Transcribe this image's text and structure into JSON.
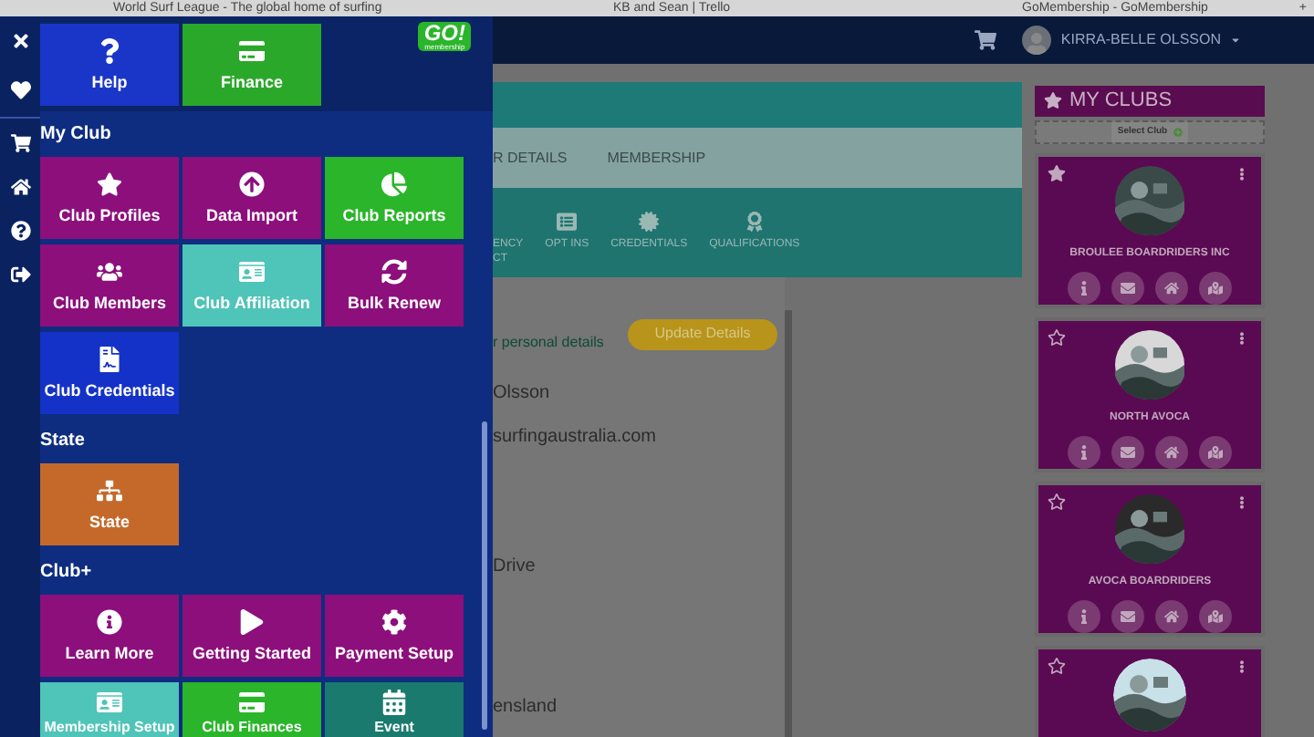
{
  "browser_tabs": [
    {
      "title": "World Surf League - The global home of surfing"
    },
    {
      "title": "KB and Sean | Trello"
    },
    {
      "title": "GoMembership - GoMembership"
    }
  ],
  "new_tab": "+",
  "top_bar": {
    "user_name": "KIRRA-BELLE OLSSON"
  },
  "drawer": {
    "logo": {
      "text": "GO!",
      "tagline": "membership"
    },
    "top_tiles": [
      {
        "label": "Help",
        "color": "#1a36c8"
      },
      {
        "label": "Finance",
        "color": "#2aa82a"
      }
    ],
    "sections": [
      {
        "heading": "My Club",
        "tiles": [
          {
            "label": "Club Profiles",
            "color": "#8c0f7c"
          },
          {
            "label": "Data Import",
            "color": "#8c0f7c"
          },
          {
            "label": "Club Reports",
            "color": "#2ab52a"
          },
          {
            "label": "Club Members",
            "color": "#8c0f7c"
          },
          {
            "label": "Club Affiliation",
            "color": "#4fc4b8"
          },
          {
            "label": "Bulk Renew",
            "color": "#8c0f7c"
          },
          {
            "label": "Club Credentials",
            "color": "#1432c8"
          }
        ]
      },
      {
        "heading": "State",
        "tiles": [
          {
            "label": "State",
            "color": "#c4692a"
          }
        ]
      },
      {
        "heading": "Club+",
        "tiles": [
          {
            "label": "Learn More",
            "color": "#8c0f7c"
          },
          {
            "label": "Getting Started",
            "color": "#8c0f7c"
          },
          {
            "label": "Payment Setup",
            "color": "#8c0f7c"
          },
          {
            "label": "Membership Setup",
            "color": "#4fc4b8"
          },
          {
            "label": "Club Finances",
            "color": "#2ab52a"
          },
          {
            "label": "Event",
            "color": "#1a7a6e"
          }
        ]
      }
    ]
  },
  "page": {
    "tabs": [
      {
        "label": "R DETAILS"
      },
      {
        "label": "MEMBERSHIP"
      }
    ],
    "icon_tabs": [
      {
        "lines": [
          "ENCY",
          "CT"
        ]
      },
      {
        "lines": [
          "OPT INS"
        ]
      },
      {
        "lines": [
          "CREDENTIALS"
        ]
      },
      {
        "lines": [
          "QUALIFICATIONS"
        ]
      }
    ],
    "details": {
      "heading": "r personal details",
      "update_button": "Update Details",
      "fields": [
        "Olsson",
        "surfingaustralia.com",
        "Drive",
        "ensland"
      ]
    }
  },
  "my_clubs": {
    "title": "MY CLUBS",
    "select_button": "Select Club",
    "clubs": [
      {
        "name": "BROULEE BOARDRIDERS INC",
        "favorite": true
      },
      {
        "name": "NORTH AVOCA",
        "favorite": false
      },
      {
        "name": "AVOCA BOARDRIDERS",
        "favorite": false
      },
      {
        "favorite": false
      }
    ]
  }
}
